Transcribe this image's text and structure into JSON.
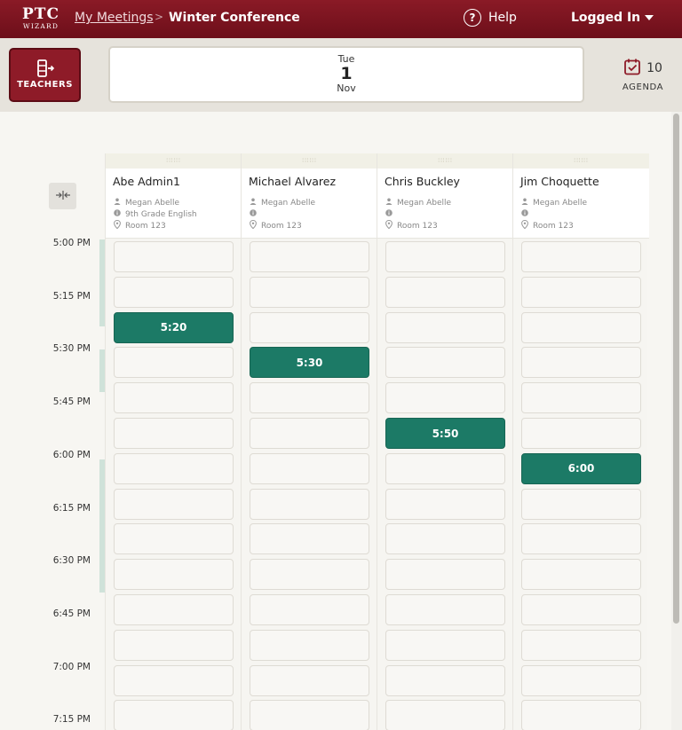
{
  "header": {
    "logo_line1": "PTC",
    "logo_line2": "WIZARD",
    "breadcrumb_link": "My Meetings",
    "breadcrumb_sep": ">",
    "breadcrumb_current": "Winter Conference",
    "help_label": "Help",
    "account_label": "Logged In"
  },
  "toolbar": {
    "teachers_label": "TEACHERS",
    "date": {
      "weekday": "Tue",
      "day": "1",
      "month": "Nov"
    },
    "agenda_count": "10",
    "agenda_label": "AGENDA"
  },
  "times": [
    "5:00 PM",
    "5:15 PM",
    "5:30 PM",
    "5:45 PM",
    "6:00 PM",
    "6:15 PM",
    "6:30 PM",
    "6:45 PM",
    "7:00 PM",
    "7:15 PM"
  ],
  "teachers": [
    {
      "name": "Abe Admin1",
      "contact": "Megan Abelle",
      "subject": "9th Grade English",
      "room": "Room 123"
    },
    {
      "name": "Michael Alvarez",
      "contact": "Megan Abelle",
      "subject": "",
      "room": "Room 123"
    },
    {
      "name": "Chris Buckley",
      "contact": "Megan Abelle",
      "subject": "",
      "room": "Room 123"
    },
    {
      "name": "Jim Choquette",
      "contact": "Megan Abelle",
      "subject": "",
      "room": "Room 123"
    }
  ],
  "booked": [
    "5:20",
    "5:30",
    "5:50",
    "6:00"
  ],
  "colors": {
    "brand": "#7a1420",
    "booked": "#1c7a66"
  }
}
